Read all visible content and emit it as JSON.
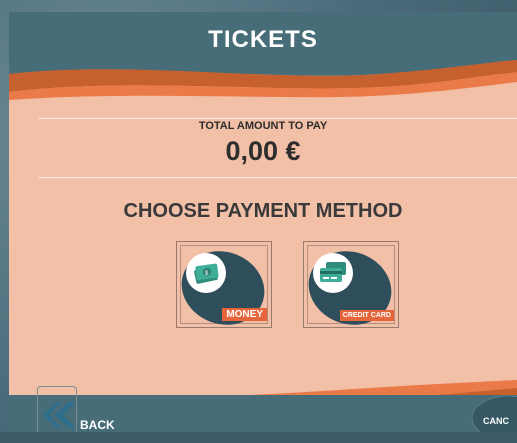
{
  "screen": {
    "title": "TICKETS"
  },
  "payment": {
    "total_label": "TOTAL AMOUNT TO PAY",
    "total_value": "0,00 €",
    "choose_heading": "CHOOSE PAYMENT METHOD",
    "methods": [
      {
        "label": "MONEY",
        "icon": "banknotes-icon"
      },
      {
        "label": "CREDIT CARD",
        "icon": "credit-card-icon"
      }
    ]
  },
  "footer": {
    "back_label": "BACK",
    "cancel_label": "CANC"
  },
  "colors": {
    "header": "#466d78",
    "panel": "#f2bfa7",
    "accent_orange": "#e7653a",
    "wave_dark": "#bf5a2f",
    "icon_teal": "#3fae98"
  }
}
